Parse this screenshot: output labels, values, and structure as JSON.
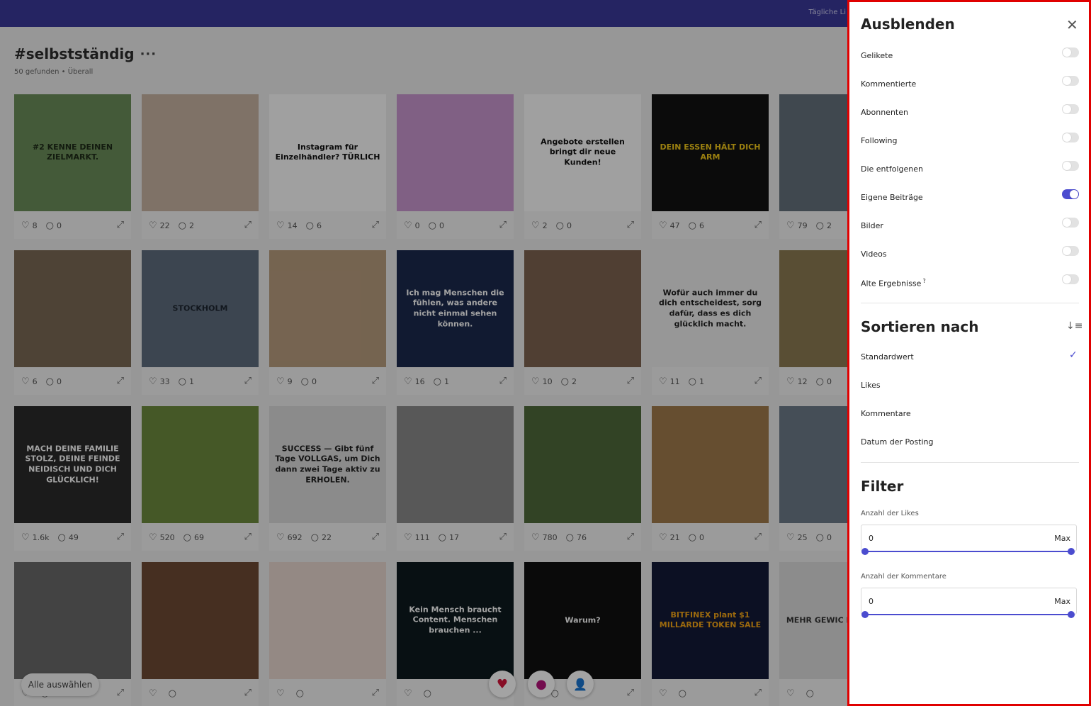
{
  "topbar": {
    "text": "Tägliche Li"
  },
  "page": {
    "title": "#selbstständig",
    "more": "···",
    "found": "50 gefunden",
    "scope": "Überall"
  },
  "icons": {
    "like": "heart-outline-icon",
    "comment": "comment-bubble-icon",
    "expand": "expand-icon",
    "close": "close-icon",
    "sort": "sort-descending-icon",
    "check": "checkmark-icon"
  },
  "colors": {
    "topbar": "#3b3999",
    "accent": "#4b4ccf",
    "panel_border": "#e00000"
  },
  "posts": [
    {
      "likes": "8",
      "comments": "0",
      "caption": "#2 KENNE DEINEN ZIELMARKT.",
      "bg": "#6b8e5a",
      "fg": "#1e2b18"
    },
    {
      "likes": "22",
      "comments": "2",
      "caption": "",
      "bg": "#c7b3a1",
      "fg": "#fff"
    },
    {
      "likes": "14",
      "comments": "6",
      "caption": "Instagram für Einzelhändler? TÜRLICH",
      "bg": "#fafafa",
      "fg": "#111"
    },
    {
      "likes": "0",
      "comments": "0",
      "caption": "",
      "bg": "#c997cf",
      "fg": "#fff"
    },
    {
      "likes": "2",
      "comments": "0",
      "caption": "Angebote erstellen bringt dir neue Kunden!",
      "bg": "#fbfbfb",
      "fg": "#111"
    },
    {
      "likes": "47",
      "comments": "6",
      "caption": "DEIN ESSEN HÄLT DICH ARM",
      "bg": "#121212",
      "fg": "#f2c81a"
    },
    {
      "likes": "79",
      "comments": "2",
      "caption": "",
      "bg": "#64717c",
      "fg": "#fff"
    },
    {
      "likes": "6",
      "comments": "0",
      "caption": "",
      "bg": "#7a6a55",
      "fg": "#fff"
    },
    {
      "likes": "33",
      "comments": "1",
      "caption": "STOCKHOLM",
      "bg": "#5e6d7d",
      "fg": "#1d2530"
    },
    {
      "likes": "9",
      "comments": "0",
      "caption": "",
      "bg": "#b89d7e",
      "fg": "#fff"
    },
    {
      "likes": "16",
      "comments": "1",
      "caption": "Ich mag Menschen die fühlen, was andere nicht einmal sehen können.",
      "bg": "#1c2a4d",
      "fg": "#ffffff"
    },
    {
      "likes": "10",
      "comments": "2",
      "caption": "",
      "bg": "#7d6350",
      "fg": "#fff"
    },
    {
      "likes": "11",
      "comments": "1",
      "caption": "Wofür auch immer du dich entscheidest, sorg dafür, dass es dich glücklich macht.",
      "bg": "#ececec",
      "fg": "#222"
    },
    {
      "likes": "12",
      "comments": "0",
      "caption": "",
      "bg": "#8b7a52",
      "fg": "#fff"
    },
    {
      "likes": "1.6k",
      "comments": "49",
      "caption": "MACH DEINE FAMILIE STOLZ, DEINE FEINDE NEIDISCH UND DICH GLÜCKLICH!",
      "bg": "#2b2b2b",
      "fg": "#ffffff"
    },
    {
      "likes": "520",
      "comments": "69",
      "caption": "",
      "bg": "#6d8a3d",
      "fg": "#fff"
    },
    {
      "likes": "692",
      "comments": "22",
      "caption": "SUCCESS — Gibt fünf Tage VOLLGAS, um Dich dann zwei Tage aktiv zu ERHOLEN.",
      "bg": "#d9d9d9",
      "fg": "#222"
    },
    {
      "likes": "111",
      "comments": "17",
      "caption": "",
      "bg": "#8a8a8a",
      "fg": "#fff"
    },
    {
      "likes": "780",
      "comments": "76",
      "caption": "",
      "bg": "#4f6a3a",
      "fg": "#fff"
    },
    {
      "likes": "21",
      "comments": "0",
      "caption": "",
      "bg": "#a07a4c",
      "fg": "#fff"
    },
    {
      "likes": "25",
      "comments": "0",
      "caption": "",
      "bg": "#6c7a88",
      "fg": "#fff"
    },
    {
      "likes": "",
      "comments": "",
      "caption": "",
      "bg": "#6a6a6a",
      "fg": "#fff"
    },
    {
      "likes": "",
      "comments": "",
      "caption": "",
      "bg": "#6e4a34",
      "fg": "#fff"
    },
    {
      "likes": "",
      "comments": "",
      "caption": "",
      "bg": "#e8d7cf",
      "fg": "#fff"
    },
    {
      "likes": "",
      "comments": "",
      "caption": "Kein Mensch braucht Content. Menschen brauchen ...",
      "bg": "#0d1a1e",
      "fg": "#ffffff"
    },
    {
      "likes": "",
      "comments": "",
      "caption": "Warum?",
      "bg": "#111111",
      "fg": "#ffffff"
    },
    {
      "likes": "",
      "comments": "",
      "caption": "BITFINEX plant $1 MILLARDE TOKEN SALE",
      "bg": "#141a38",
      "fg": "#f2a516"
    },
    {
      "likes": "",
      "comments": "",
      "caption": "MEHR GEWIC DIE HAND",
      "bg": "#dcdcdc",
      "fg": "#333"
    }
  ],
  "bottom": {
    "select_all": "Alle auswählen",
    "fab_likes": "heart-icon",
    "fab_comments": "comment-icon",
    "fab_follow": "add-user-icon"
  },
  "panel": {
    "hide": {
      "title": "Ausblenden",
      "items": [
        {
          "label": "Gelikete",
          "on": false
        },
        {
          "label": "Kommentierte",
          "on": false
        },
        {
          "label": "Abonnenten",
          "on": false
        },
        {
          "label": "Following",
          "on": false
        },
        {
          "label": "Die entfolgenen",
          "on": false
        },
        {
          "label": "Eigene Beiträge",
          "on": true
        },
        {
          "label": "Bilder",
          "on": false
        },
        {
          "label": "Videos",
          "on": false
        },
        {
          "label": "Alte Ergebnisse",
          "on": false,
          "sup": "?"
        }
      ]
    },
    "sort": {
      "title": "Sortieren nach",
      "items": [
        {
          "label": "Standardwert",
          "selected": true
        },
        {
          "label": "Likes",
          "selected": false
        },
        {
          "label": "Kommentare",
          "selected": false
        },
        {
          "label": "Datum der Posting",
          "selected": false
        }
      ]
    },
    "filter": {
      "title": "Filter",
      "likes": {
        "label": "Anzahl der Likes",
        "min": "0",
        "max": "Max"
      },
      "comments": {
        "label": "Anzahl der Kommentare",
        "min": "0",
        "max": "Max"
      }
    }
  }
}
